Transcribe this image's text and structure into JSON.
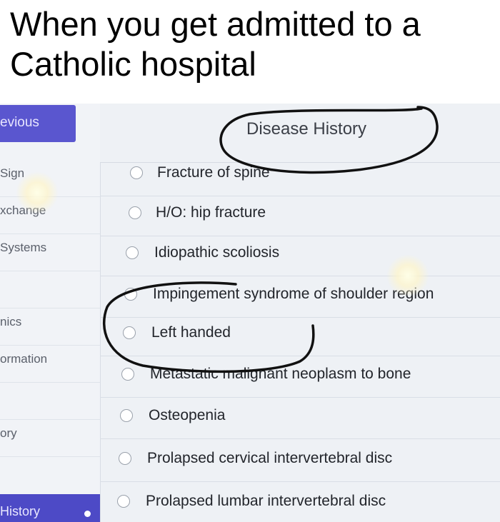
{
  "caption": "When you get admitted to a Catholic hospital",
  "sidebar": {
    "previous_label": "evious",
    "items": [
      {
        "label": "Sign"
      },
      {
        "label": "xchange"
      },
      {
        "label": "Systems"
      },
      {
        "label": ""
      },
      {
        "label": "nics"
      },
      {
        "label": "ormation"
      },
      {
        "label": ""
      },
      {
        "label": "ory"
      }
    ],
    "active_label": "History"
  },
  "panel": {
    "title": "Disease History",
    "options": [
      {
        "label": "Fracture of spine"
      },
      {
        "label": "H/O: hip fracture"
      },
      {
        "label": "Idiopathic scoliosis"
      },
      {
        "label": "Impingement syndrome of shoulder region"
      },
      {
        "label": "Left handed"
      },
      {
        "label": "Metastatic malignant neoplasm to bone"
      },
      {
        "label": "Osteopenia"
      },
      {
        "label": "Prolapsed cervical intervertebral disc"
      },
      {
        "label": "Prolapsed lumbar intervertebral disc"
      }
    ]
  },
  "colors": {
    "accent": "#5a56cf",
    "marker": "#111111"
  }
}
